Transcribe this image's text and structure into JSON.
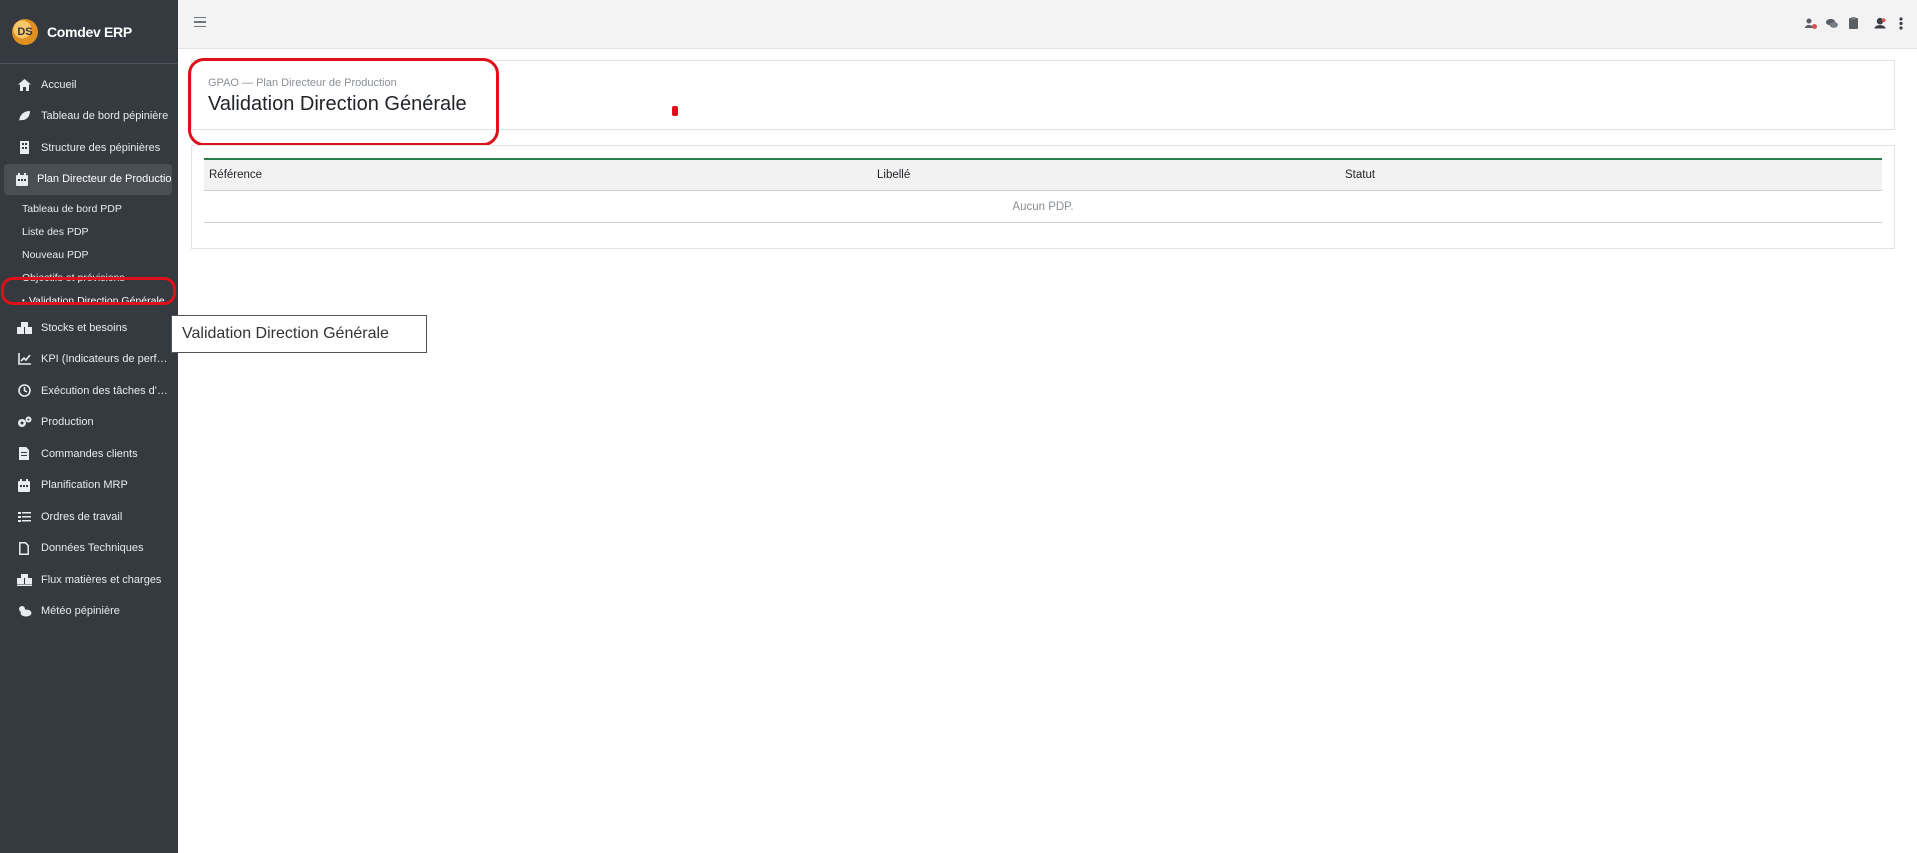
{
  "app": {
    "name": "Comdev ERP",
    "logo_text": "DS"
  },
  "sidebar": {
    "items": [
      {
        "label": "Accueil",
        "icon": "home-icon"
      },
      {
        "label": "Tableau de bord pépinière",
        "icon": "leaf-icon"
      },
      {
        "label": "Structure des pépinières",
        "icon": "building-icon"
      },
      {
        "label": "Plan Directeur de Production",
        "icon": "calendar-icon",
        "active": true
      },
      {
        "label": "Stocks et besoins",
        "icon": "boxes-icon"
      },
      {
        "label": "KPI (Indicateurs de perf…",
        "icon": "chart-line-icon"
      },
      {
        "label": "Exécution des tâches d'…",
        "icon": "clock-icon"
      },
      {
        "label": "Production",
        "icon": "cogs-icon"
      },
      {
        "label": "Commandes clients",
        "icon": "invoice-icon"
      },
      {
        "label": "Planification MRP",
        "icon": "calendar-icon"
      },
      {
        "label": "Ordres de travail",
        "icon": "tasks-icon"
      },
      {
        "label": "Données Techniques",
        "icon": "file-icon"
      },
      {
        "label": "Flux matières et charges",
        "icon": "dolly-icon"
      },
      {
        "label": "Météo pépinière",
        "icon": "cloud-sun-icon"
      }
    ],
    "submenu": [
      {
        "label": "Tableau de bord PDP"
      },
      {
        "label": "Liste des PDP"
      },
      {
        "label": "Nouveau PDP"
      },
      {
        "label": "Objectifs et prévisions"
      },
      {
        "label": "Validation Direction Générale",
        "current": true,
        "bullet": "•"
      }
    ]
  },
  "header": {
    "breadcrumb": "GPAO — Plan Directeur de Production",
    "title": "Validation Direction Générale"
  },
  "table": {
    "columns": [
      "Référence",
      "Libellé",
      "Statut"
    ],
    "empty_message": "Aucun PDP."
  },
  "tooltip": {
    "text": "Validation Direction Générale"
  },
  "colors": {
    "sidebar_bg": "#343a40",
    "accent_green": "#2e7d4f",
    "highlight_red": "#e0101a"
  }
}
